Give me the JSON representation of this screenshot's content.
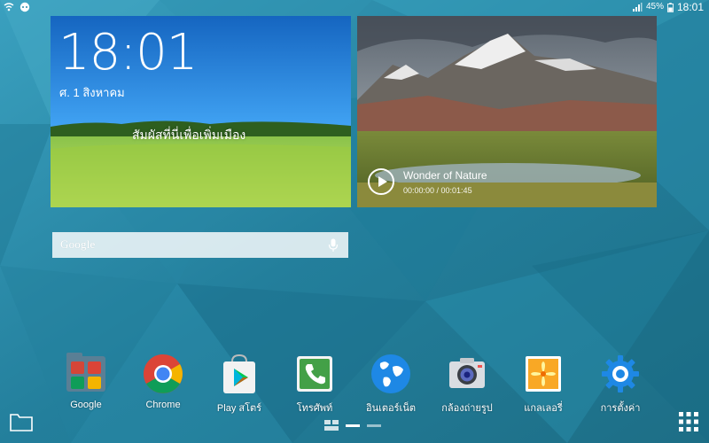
{
  "status_bar": {
    "battery_percent": "45%",
    "time": "18:01"
  },
  "clock_widget": {
    "time": "18:01",
    "date": "ศ. 1 สิงหาคม",
    "slogan": "สัมผัสที่นี่เพื่อเพิ่มเมือง"
  },
  "video_widget": {
    "title": "Wonder of Nature",
    "progress": "00:00:00 / 00:01:45"
  },
  "search": {
    "label": "Google",
    "icon": "mic-icon"
  },
  "dock": {
    "apps": [
      {
        "label": "Google",
        "icon": "google-folder-icon"
      },
      {
        "label": "Chrome",
        "icon": "chrome-icon"
      },
      {
        "label": "Play สโตร์",
        "icon": "play-store-icon"
      },
      {
        "label": "โทรศัพท์",
        "icon": "phone-icon"
      },
      {
        "label": "อินเตอร์เน็ต",
        "icon": "internet-globe-icon"
      },
      {
        "label": "กล้องถ่ายรูป",
        "icon": "camera-icon"
      },
      {
        "label": "แกลเลอรี่",
        "icon": "gallery-icon"
      },
      {
        "label": "การตั้งค่า",
        "icon": "settings-gear-icon"
      }
    ]
  },
  "colors": {
    "wallpaper": "#2a8aa8",
    "accent": "#1e9bd7"
  }
}
